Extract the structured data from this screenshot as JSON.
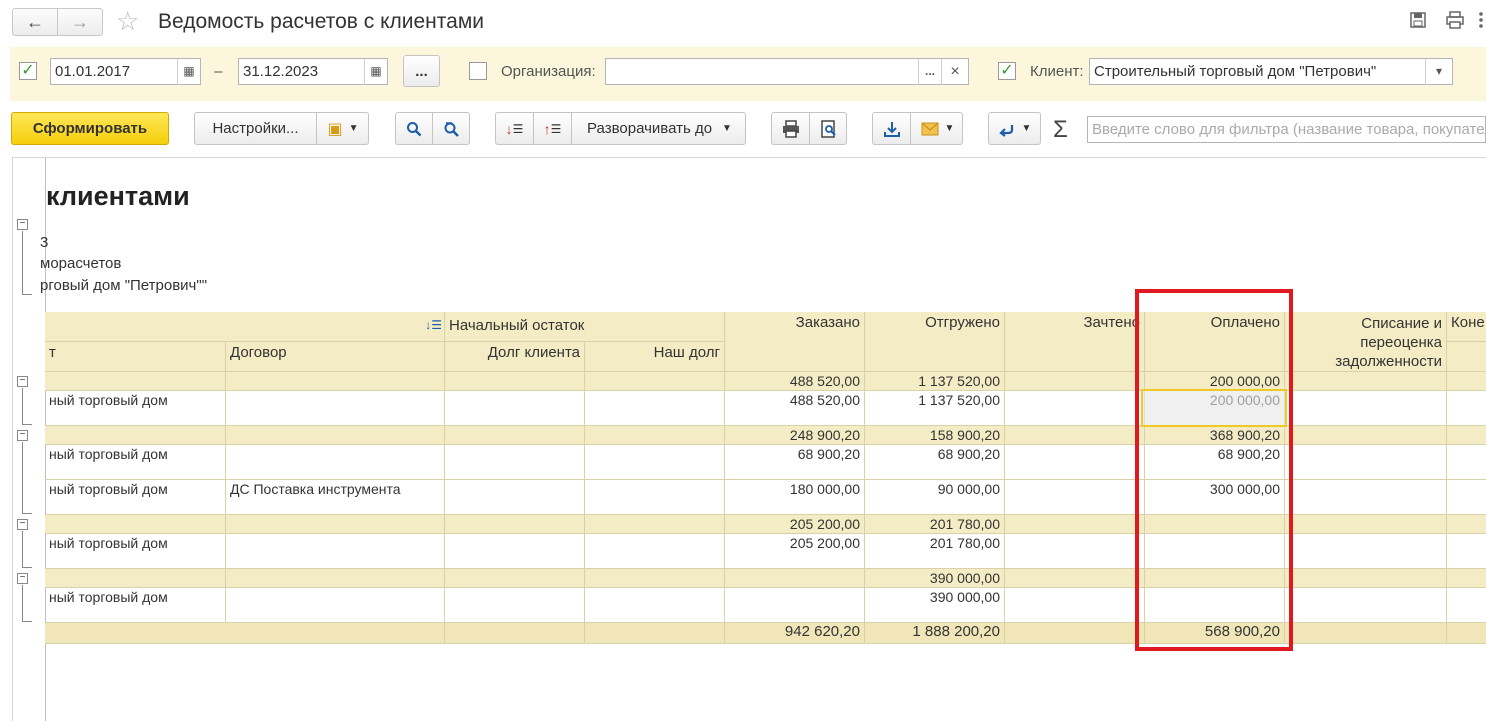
{
  "window": {
    "title": "Ведомость расчетов с клиентами",
    "back_icon": "←",
    "forward_icon": "→",
    "star_icon": "☆"
  },
  "filters": {
    "date_from": "01.01.2017",
    "dash": "–",
    "date_to": "31.12.2023",
    "period_button": "...",
    "org_label": "Организация:",
    "org_value": "",
    "org_select": "...",
    "org_clear": "×",
    "client_label": "Клиент:",
    "client_value": "Строительный торговый дом \"Петрович\""
  },
  "toolbar": {
    "generate": "Сформировать",
    "settings": "Настройки...",
    "expand_to": "Разворачивать до",
    "filter_placeholder": "Введите слово для фильтра (название товара, покупателя...)"
  },
  "report": {
    "title": "клиентами",
    "header_lines": [
      "3",
      "морасчетов",
      "рговый дом \"Петрович\"\""
    ],
    "columns": {
      "initial_balance": "Начальный остаток",
      "partner": "т",
      "contract": "Договор",
      "client_debt": "Долг клиента",
      "our_debt": "Наш долг",
      "ordered": "Заказано",
      "shipped": "Отгружено",
      "offset": "Зачтено",
      "paid": "Оплачено",
      "writeoff_1": "Списание и",
      "writeoff_2": "переоценка",
      "writeoff_3": "задолженности",
      "final": "Коне"
    },
    "rows": [
      {
        "kind": "group",
        "partner": "",
        "contract": "",
        "ordered": "488 520,00",
        "shipped": "1 137 520,00",
        "offset": "",
        "paid": "200 000,00"
      },
      {
        "kind": "detail",
        "partner": "ный торговый дом",
        "contract": "",
        "ordered": "488 520,00",
        "shipped": "1 137 520,00",
        "offset": "",
        "paid": "200 000,00"
      },
      {
        "kind": "group",
        "partner": "",
        "contract": "",
        "ordered": "248 900,20",
        "shipped": "158 900,20",
        "offset": "",
        "paid": "368 900,20"
      },
      {
        "kind": "detail",
        "partner": "ный торговый дом",
        "contract": "",
        "ordered": "68 900,20",
        "shipped": "68 900,20",
        "offset": "",
        "paid": "68 900,20"
      },
      {
        "kind": "detail",
        "partner": "ный торговый дом",
        "contract": "ДС Поставка инструмента",
        "ordered": "180 000,00",
        "shipped": "90 000,00",
        "offset": "",
        "paid": "300 000,00"
      },
      {
        "kind": "group",
        "partner": "",
        "contract": "",
        "ordered": "205 200,00",
        "shipped": "201 780,00",
        "offset": "",
        "paid": ""
      },
      {
        "kind": "detail",
        "partner": "ный торговый дом",
        "contract": "",
        "ordered": "205 200,00",
        "shipped": "201 780,00",
        "offset": "",
        "paid": ""
      },
      {
        "kind": "group",
        "partner": "",
        "contract": "",
        "ordered": "",
        "shipped": "390 000,00",
        "offset": "",
        "paid": ""
      },
      {
        "kind": "detail",
        "partner": "ный торговый дом",
        "contract": "",
        "ordered": "",
        "shipped": "390 000,00",
        "offset": "",
        "paid": ""
      }
    ],
    "totals": {
      "ordered": "942 620,20",
      "shipped": "1 888 200,20",
      "paid": "568 900,20"
    }
  },
  "colors": {
    "accent_yellow": "#f5cf0a",
    "filter_panel_bg": "#fbf6dc",
    "table_header_bg": "#f4ecc5",
    "highlight_red": "#e0191f",
    "check_green": "#3a9b35"
  }
}
